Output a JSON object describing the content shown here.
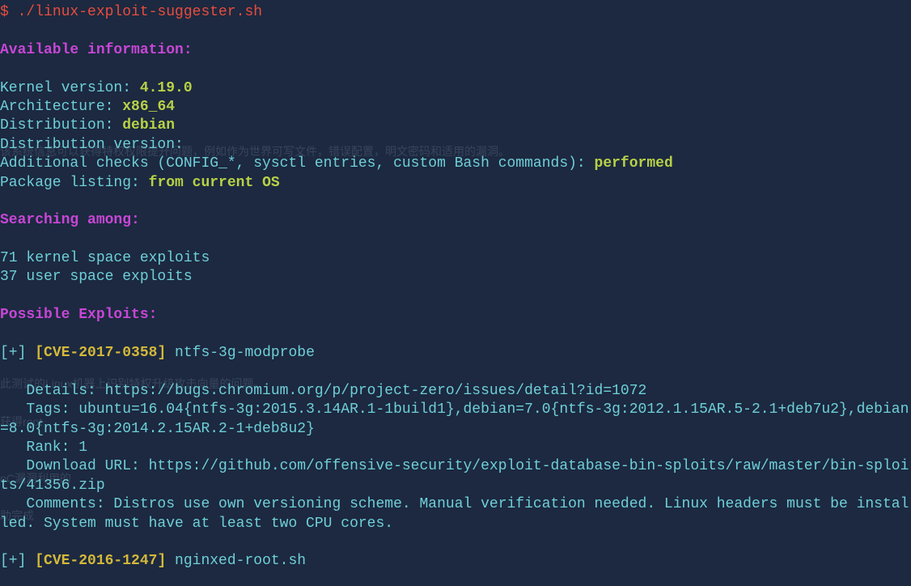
{
  "prompt": "$ ",
  "command": "./linux-exploit-suggester.sh",
  "sections": {
    "available_header": "Available information:",
    "kernel_label": "Kernel version: ",
    "kernel_value": "4.19.0",
    "arch_label": "Architecture: ",
    "arch_value": "x86_64",
    "distro_label": "Distribution: ",
    "distro_value": "debian",
    "distro_version_label": "Distribution version: ",
    "distro_version_value": "",
    "additional_label": "Additional checks (CONFIG_*, sysctl entries, custom Bash commands): ",
    "additional_value": "performed",
    "package_label": "Package listing: ",
    "package_value": "from current OS",
    "searching_header": "Searching among:",
    "kernel_exploits": "71 kernel space exploits",
    "user_exploits": "37 user space exploits",
    "possible_header": "Possible Exploits:",
    "exploit1_plus": "[+] ",
    "exploit1_cve": "[CVE-2017-0358]",
    "exploit1_name": " ntfs-3g-modprobe",
    "exploit1_details": "   Details: https://bugs.chromium.org/p/project-zero/issues/detail?id=1072",
    "exploit1_tags": "   Tags: ubuntu=16.04{ntfs-3g:2015.3.14AR.1-1build1},debian=7.0{ntfs-3g:2012.1.15AR.5-2.1+deb7u2},debian=8.0{ntfs-3g:2014.2.15AR.2-1+deb8u2}",
    "exploit1_rank": "   Rank: 1",
    "exploit1_download": "   Download URL: https://github.com/offensive-security/exploit-database-bin-sploits/raw/master/bin-sploits/41356.zip",
    "exploit1_comments": "   Comments: Distros use own versioning scheme. Manual verification needed. Linux headers must be installed. System must have at least two CPU cores.",
    "exploit2_plus": "[+] ",
    "exploit2_cve": "[CVE-2016-1247]",
    "exploit2_name": " nginxed-root.sh"
  },
  "ghost": {
    "g1": "该系统信息可以获得特权权限提升问题，例如作为世界可写文件，错误配置，明文密码和适用的漏洞。",
    "g2": "此测试的Linux机器上识别特权升级攻击向量的问题。",
    "g3": "获得root",
    "g4": "oC漏洞利用的",
    "g5": "助完成"
  }
}
